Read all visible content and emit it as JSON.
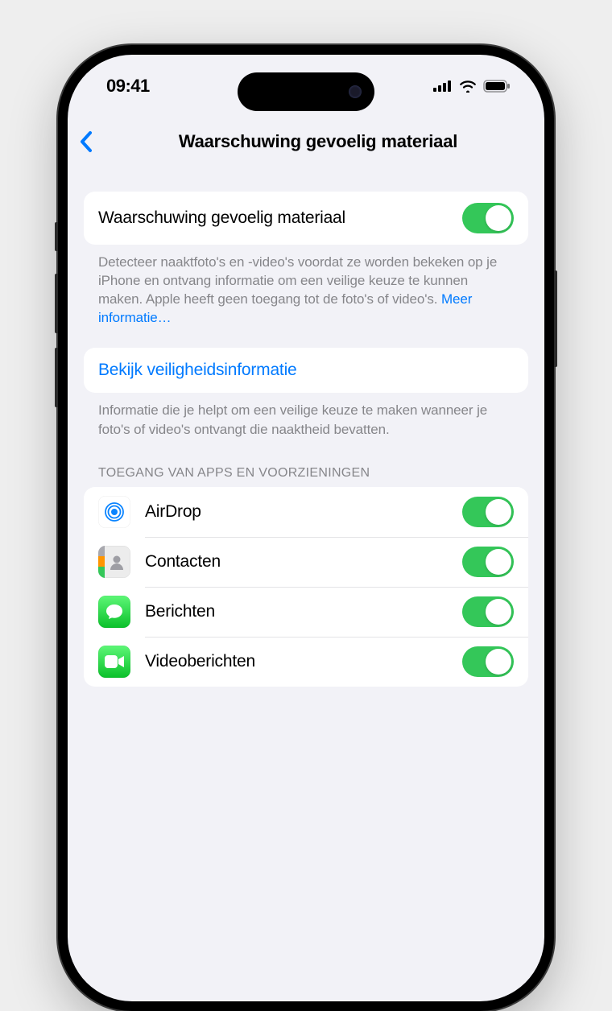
{
  "status": {
    "time": "09:41"
  },
  "nav": {
    "title": "Waarschuwing gevoelig materiaal"
  },
  "main_toggle": {
    "label": "Waarschuwing gevoelig materiaal",
    "on": true,
    "footer": "Detecteer naaktfoto's en -video's voordat ze worden bekeken op je iPhone en ontvang informatie om een veilige keuze te kunnen maken. Apple heeft geen toegang tot de foto's of video's. ",
    "more_link": "Meer informatie…"
  },
  "safety_link": {
    "label": "Bekijk veiligheidsinformatie",
    "footer": "Informatie die je helpt om een veilige keuze te maken wanneer je foto's of video's ontvangt die naaktheid bevatten."
  },
  "apps_section": {
    "header": "TOEGANG VAN APPS EN VOORZIENINGEN",
    "items": [
      {
        "label": "AirDrop",
        "on": true,
        "icon": "airdrop"
      },
      {
        "label": "Contacten",
        "on": true,
        "icon": "contacts"
      },
      {
        "label": "Berichten",
        "on": true,
        "icon": "messages"
      },
      {
        "label": "Videoberichten",
        "on": true,
        "icon": "facetime"
      }
    ]
  }
}
